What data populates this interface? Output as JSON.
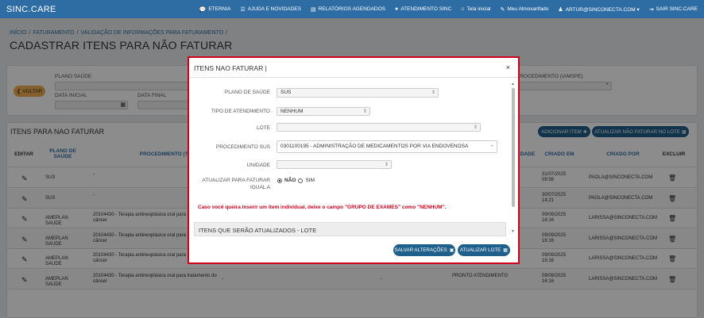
{
  "app": {
    "brand": "SINC.CARE",
    "nav": [
      {
        "icon": "chat-icon",
        "glyph": "💬",
        "label": "ETERNIA"
      },
      {
        "icon": "rss-icon",
        "glyph": "☰",
        "label": "AJUDA E NOVIDADES"
      },
      {
        "icon": "report-icon",
        "glyph": "▤",
        "label": "RELATÓRIOS AGENDADOS"
      },
      {
        "icon": "help-icon",
        "glyph": "●",
        "label": "ATENDIMENTO SINC"
      },
      {
        "icon": "home-icon",
        "glyph": "⌂",
        "label": "Tela inicial"
      },
      {
        "icon": "edit-icon",
        "glyph": "✎",
        "label": "Meu Almoxarifado"
      },
      {
        "icon": "user-icon",
        "glyph": "♟",
        "label": "ARTUR@SINCONECTA.COM ▾"
      },
      {
        "icon": "logout-icon",
        "glyph": "⇥",
        "label": "SAIR SINC.CARE"
      }
    ]
  },
  "breadcrumb": {
    "items": [
      "INÍCIO",
      "FATURAMENTO",
      "VALIDAÇÃO DE INFORMAÇÕES PARA FATURAMENTO"
    ],
    "separator": "/",
    "trailing": "/"
  },
  "page_title": "CADASTRAR ITENS PARA NÃO FATURAR",
  "filters": {
    "voltar": "VOLTAR",
    "plano_saude": "PLANO SAÚDE",
    "data_inicial": "DATA INICIAL",
    "data_final": "DATA FINAL",
    "procedimento_iamspe": "PROCEDIMENTO (IAMSPE)"
  },
  "list": {
    "title": "ITENS PARA NAO FATURAR",
    "add_button": "ADICIONAR ITEM",
    "update_button": "ATUALIZAR NÃO FATURAR NO LOTE",
    "columns": {
      "editar": "EDITAR",
      "plano": "PLANO DE SAÚDE",
      "procedimento": "PROCEDIMENTO (TUSS)",
      "idade": "DADE",
      "criado_em": "CRIADO EM",
      "criado_por": "CRIADO POR",
      "excluir": "EXCLUIR"
    },
    "rows": [
      {
        "plano": "SUS",
        "proc": "-",
        "mid": "",
        "mid2": "",
        "status": "",
        "date": "31/07/2025",
        "time": "09:56",
        "by": "PAOLA@SINCONECTA.COM"
      },
      {
        "plano": "SUS",
        "proc": "-",
        "mid": "",
        "mid2": "",
        "status": "",
        "date": "30/07/2025",
        "time": "14:21",
        "by": "PAOLA@SINCONECTA.COM"
      },
      {
        "plano": "AMEPLAN SAUDE",
        "proc": "20104430 - Terapia antineoplásica oral para tratamento do câncer",
        "mid": "",
        "mid2": "",
        "status": "",
        "date": "09/09/2025",
        "time": "16:16",
        "by": "LARISSA@SINCONECTA.COM"
      },
      {
        "plano": "AMEPLAN SAUDE",
        "proc": "20104430 - Terapia antineoplásica oral para tratamento do câncer",
        "mid": "",
        "mid2": "",
        "status": "",
        "date": "09/09/2025",
        "time": "16:16",
        "by": "LARISSA@SINCONECTA.COM"
      },
      {
        "plano": "AMEPLAN SAUDE",
        "proc": "20104430 - Terapia antineoplásica oral para tratamento do câncer",
        "mid": "-",
        "mid2": "-",
        "status": "PRONTO ATENDIMENTO",
        "date": "09/09/2025",
        "time": "16:16",
        "by": "LARISSA@SINCONECTA.COM"
      },
      {
        "plano": "AMEPLAN SAUDE",
        "proc": "20104430 - Terapia antineoplásica oral para tratamento do câncer",
        "mid": "-",
        "mid2": "-",
        "status": "PRONTO ATENDIMENTO",
        "date": "09/09/2025",
        "time": "16:16",
        "by": "LARISSA@SINCONECTA.COM"
      }
    ]
  },
  "modal": {
    "title": "ITENS NAO FATURAR |",
    "close": "×",
    "fields": {
      "plano_label": "PLANO DE SAÚDE",
      "plano_value": "SUS",
      "tipo_label": "TIPO DE ATENDIMENTO",
      "tipo_value": "NENHUM",
      "lote_label": "LOTE",
      "lote_value": "",
      "proc_label": "PROCEDIMENTO SUS",
      "proc_value": "0301100195 - ADMINISTRAÇÃO DE MEDICAMENTOS POR VIA ENDOVENOSA",
      "unidade_label": "UNIDADE",
      "unidade_value": "",
      "atualizar_label_1": "ATUALIZAR PARA FATURAR",
      "atualizar_label_2": "IGUAL A",
      "nao": "NÃO",
      "sim": "SIM"
    },
    "warning": "Caso você queira inserir um ítem individual, deixe o campo \"GRUPO DE EXAMES\" como \"NENHUM\".",
    "lote_section": "ITENS QUE SERÃO ATUALIZADOS - LOTE",
    "save_button": "SALVAR ALTERAÇÕES",
    "update_lote_button": "ATUALIZAR LOTE"
  }
}
